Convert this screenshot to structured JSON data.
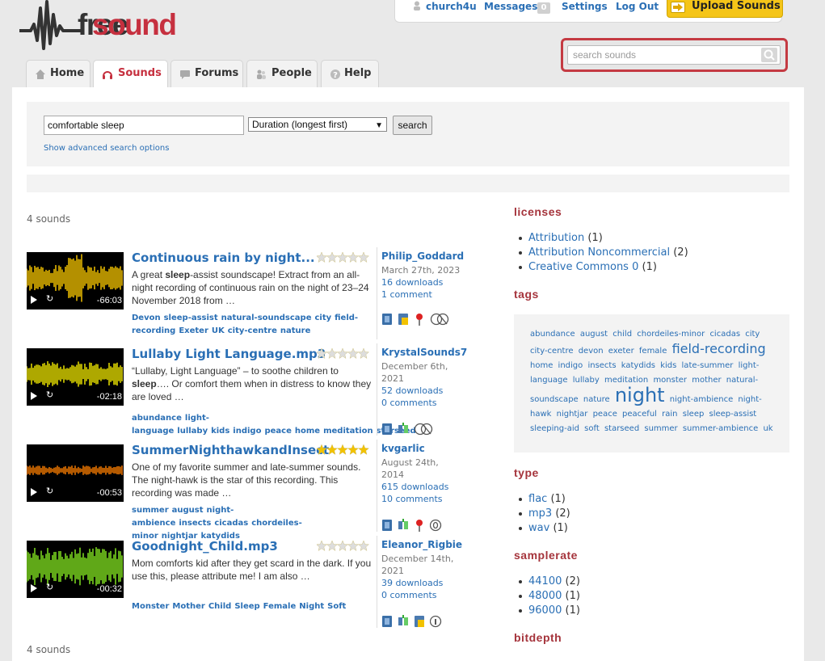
{
  "brand": {
    "free": "free",
    "sound": "sound"
  },
  "userbar": {
    "username": "church4u",
    "messages_label": "Messages",
    "messages_count": "0",
    "settings_label": "Settings",
    "logout_label": "Log Out"
  },
  "upload_label": "Upload Sounds",
  "header_search": {
    "placeholder": "search sounds"
  },
  "tabs": [
    {
      "label": "Home",
      "icon": "home-icon"
    },
    {
      "label": "Sounds",
      "icon": "headphones-icon",
      "active": true
    },
    {
      "label": "Forums",
      "icon": "speech-bubble-icon"
    },
    {
      "label": "People",
      "icon": "people-icon"
    },
    {
      "label": "Help",
      "icon": "help-icon"
    }
  ],
  "search": {
    "query": "comfortable sleep",
    "sort_selected": "Duration (longest first)",
    "button_label": "search",
    "advanced_label": "Show advanced search options"
  },
  "results_count": "4 sounds",
  "sounds": [
    {
      "title": "Continuous rain by night...",
      "rating": 0,
      "description_parts": [
        "A great ",
        "sleep",
        "-assist soundscape! Extract from an all-night recording of continuous rain on the night of 23–24 November 2018 from …"
      ],
      "tags": [
        "Devon",
        "sleep-assist",
        "natural-soundscape",
        "city",
        "field-recording",
        "Exeter",
        "UK",
        "city-centre",
        "nature"
      ],
      "author": "Philip_Goddard",
      "date": "March 27th, 2023",
      "downloads": "16 downloads",
      "comments": "1 comment",
      "duration": "-66:03",
      "wave_color": "#f0c000",
      "icons": [
        "flac-format-icon",
        "license-icon",
        "geotag-icon",
        "cc-nc-icon"
      ]
    },
    {
      "title": "Lullaby Light Language.mp3",
      "rating": 0,
      "description_parts": [
        "“Lullaby, Light Language” – to soothe children to ",
        "sleep",
        "…. Or comfort them when in distress to know they are loved …"
      ],
      "tags": [
        "abundance",
        "light-language",
        "lullaby",
        "kids",
        "indigo",
        "peace",
        "home",
        "meditation",
        "starseed"
      ],
      "author": "KrystalSounds7",
      "date": "December 6th, 2021",
      "downloads": "52 downloads",
      "comments": "0 comments",
      "duration": "-02:18",
      "wave_color": "#e8e000",
      "icons": [
        "mp3-format-icon",
        "stereo-icon",
        "cc-nc-icon"
      ]
    },
    {
      "title": "SummerNighthawkandInsect",
      "rating": 5,
      "description_parts": [
        "One of my favorite summer and late-summer sounds. The night-hawk is the star of this recording. This recording was made …",
        "",
        ""
      ],
      "tags": [
        "summer",
        "august",
        "night-ambience",
        "insects",
        "cicadas",
        "chordeiles-minor",
        "nightjar",
        "katydids"
      ],
      "author": "kvgarlic",
      "date": "August 24th, 2014",
      "downloads": "615 downloads",
      "comments": "10 comments",
      "duration": "-00:53",
      "wave_color": "#f07800",
      "icons": [
        "wav-format-icon",
        "stereo-icon",
        "geotag-icon",
        "cc0-icon"
      ]
    },
    {
      "title": "Goodnight_Child.mp3",
      "rating": 0,
      "description_parts": [
        "Mom comforts kid after they get scard in the dark. If you use this, please attribute me! I am also …",
        "",
        ""
      ],
      "tags": [
        "Monster",
        "Mother",
        "Child",
        "Sleep",
        "Female",
        "Night",
        "Soft"
      ],
      "author": "Eleanor_Rigbie",
      "date": "December 14th, 2021",
      "downloads": "39 downloads",
      "comments": "0 comments",
      "duration": "-00:32",
      "wave_color": "#80e020",
      "icons": [
        "mp3-format-icon",
        "stereo-icon",
        "license-icon",
        "attribution-icon"
      ]
    }
  ],
  "facets": {
    "licenses": {
      "title": "licenses",
      "items": [
        {
          "label": "Attribution",
          "count": "(1)"
        },
        {
          "label": "Attribution Noncommercial",
          "count": "(2)"
        },
        {
          "label": "Creative Commons 0",
          "count": "(1)"
        }
      ]
    },
    "tags": {
      "title": "tags",
      "cloud": [
        {
          "t": "abundance",
          "s": ""
        },
        {
          "t": "august",
          "s": ""
        },
        {
          "t": "child",
          "s": ""
        },
        {
          "t": "chordeiles-minor",
          "s": ""
        },
        {
          "t": "cicadas",
          "s": ""
        },
        {
          "t": "city",
          "s": ""
        },
        {
          "t": "city-centre",
          "s": ""
        },
        {
          "t": "devon",
          "s": ""
        },
        {
          "t": "exeter",
          "s": ""
        },
        {
          "t": "female",
          "s": ""
        },
        {
          "t": "field-recording",
          "s": "big1"
        },
        {
          "t": "home",
          "s": ""
        },
        {
          "t": "indigo",
          "s": ""
        },
        {
          "t": "insects",
          "s": ""
        },
        {
          "t": "katydids",
          "s": ""
        },
        {
          "t": "kids",
          "s": ""
        },
        {
          "t": "late-summer",
          "s": ""
        },
        {
          "t": "light-language",
          "s": ""
        },
        {
          "t": "lullaby",
          "s": ""
        },
        {
          "t": "meditation",
          "s": ""
        },
        {
          "t": "monster",
          "s": ""
        },
        {
          "t": "mother",
          "s": ""
        },
        {
          "t": "natural-soundscape",
          "s": ""
        },
        {
          "t": "nature",
          "s": ""
        },
        {
          "t": "night",
          "s": "big2"
        },
        {
          "t": "night-ambience",
          "s": ""
        },
        {
          "t": "night-hawk",
          "s": ""
        },
        {
          "t": "nightjar",
          "s": ""
        },
        {
          "t": "peace",
          "s": ""
        },
        {
          "t": "peaceful",
          "s": ""
        },
        {
          "t": "rain",
          "s": ""
        },
        {
          "t": "sleep",
          "s": ""
        },
        {
          "t": "sleep-assist",
          "s": ""
        },
        {
          "t": "sleeping-aid",
          "s": ""
        },
        {
          "t": "soft",
          "s": ""
        },
        {
          "t": "starseed",
          "s": ""
        },
        {
          "t": "summer",
          "s": ""
        },
        {
          "t": "summer-ambience",
          "s": ""
        },
        {
          "t": "uk",
          "s": ""
        }
      ]
    },
    "type": {
      "title": "type",
      "items": [
        {
          "label": "flac",
          "count": "(1)"
        },
        {
          "label": "mp3",
          "count": "(2)"
        },
        {
          "label": "wav",
          "count": "(1)"
        }
      ]
    },
    "samplerate": {
      "title": "samplerate",
      "items": [
        {
          "label": "44100",
          "count": "(2)"
        },
        {
          "label": "48000",
          "count": "(1)"
        },
        {
          "label": "96000",
          "count": "(1)"
        }
      ]
    },
    "bitdepth": {
      "title": "bitdepth"
    }
  },
  "colors": {
    "brand_red": "#c6303f",
    "link_blue": "#2a6fb5",
    "facet_red": "#a5343c",
    "upload_yellow": "#f5c518"
  }
}
